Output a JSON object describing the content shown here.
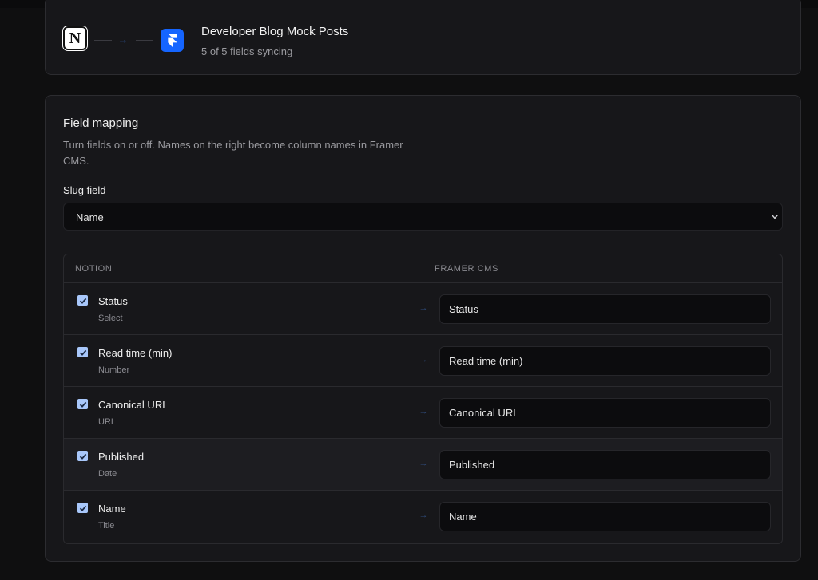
{
  "header": {
    "title": "Developer Blog Mock Posts",
    "subtitle": "5 of 5 fields syncing",
    "source_logo": "N",
    "source_icon": "notion-logo-icon",
    "target_icon": "framer-logo-icon",
    "arrow": "→"
  },
  "mapping": {
    "title": "Field mapping",
    "description": "Turn fields on or off. Names on the right become column names in Framer CMS.",
    "slug_label": "Slug field",
    "slug_value": "Name",
    "col_source": "NOTION",
    "col_target": "FRAMER CMS",
    "row_arrow": "→",
    "rows": [
      {
        "name": "Status",
        "type": "Select",
        "target": "Status",
        "checked": true
      },
      {
        "name": "Read time (min)",
        "type": "Number",
        "target": "Read time (min)",
        "checked": true
      },
      {
        "name": "Canonical URL",
        "type": "URL",
        "target": "Canonical URL",
        "checked": true
      },
      {
        "name": "Published",
        "type": "Date",
        "target": "Published",
        "checked": true
      },
      {
        "name": "Name",
        "type": "Title",
        "target": "Name",
        "checked": true
      }
    ]
  },
  "colors": {
    "background": "#0f0f10",
    "card": "#17171a",
    "accent": "#3b82f6",
    "framer_blue": "#1565ff",
    "checkbox": "#a8c7fa"
  }
}
